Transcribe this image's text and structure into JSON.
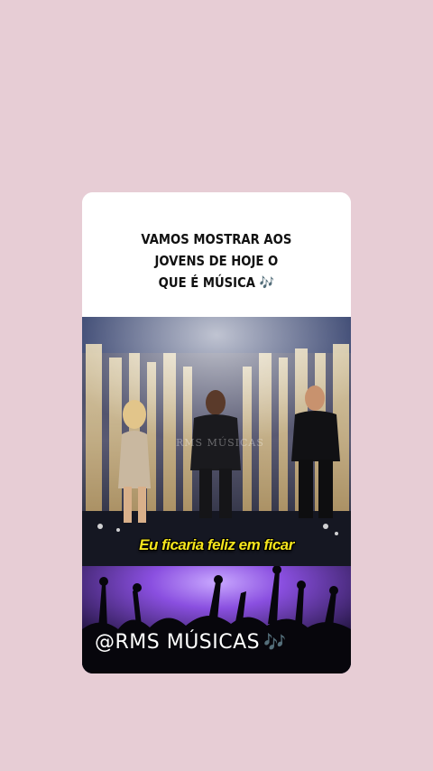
{
  "caption": {
    "line1": "VAMOS MOSTRAR AOS",
    "line2": "JOVENS DE HOJE O",
    "line3": "QUE É MÚSICA 🎶"
  },
  "video": {
    "watermark": "RMS MÚSICAS",
    "subtitle": "Eu ficaria feliz em ficar"
  },
  "banner": {
    "handle": "@RMS MÚSICAS",
    "notes": "🎶"
  },
  "colors": {
    "background": "#e7cdd5",
    "subtitle": "#f5e51c",
    "crowd_light": "#8a4fe0"
  }
}
